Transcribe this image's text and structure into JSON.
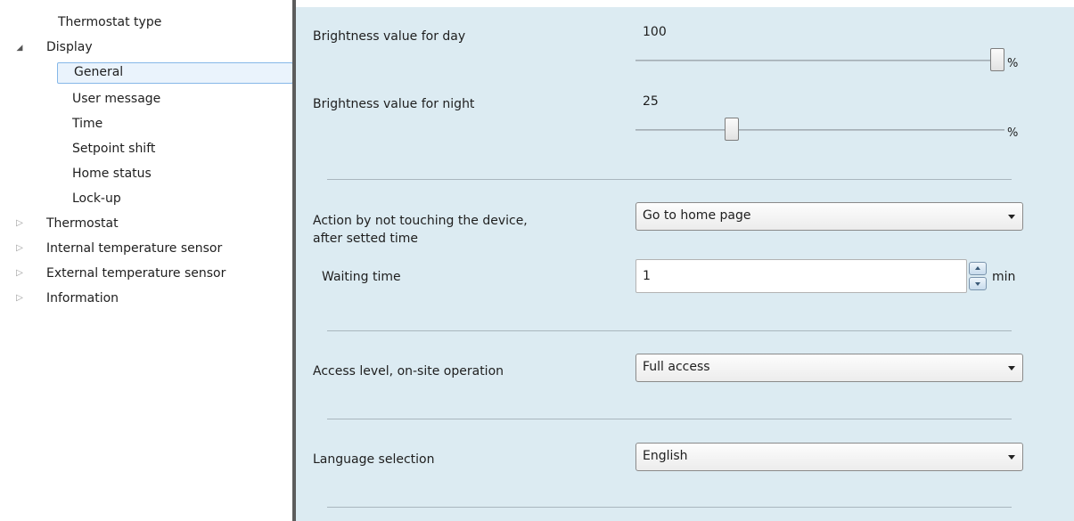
{
  "sidebar": {
    "items": [
      {
        "label": "Thermostat type",
        "state": "leaf"
      },
      {
        "label": "Display",
        "state": "expanded"
      },
      {
        "label": "General",
        "state": "selected"
      },
      {
        "label": "User message",
        "state": "leaf"
      },
      {
        "label": "Time",
        "state": "leaf"
      },
      {
        "label": "Setpoint shift",
        "state": "leaf"
      },
      {
        "label": "Home status",
        "state": "leaf"
      },
      {
        "label": "Lock-up",
        "state": "leaf"
      },
      {
        "label": "Thermostat",
        "state": "collapsed"
      },
      {
        "label": "Internal temperature sensor",
        "state": "collapsed"
      },
      {
        "label": "External temperature sensor",
        "state": "collapsed"
      },
      {
        "label": "Information",
        "state": "collapsed"
      }
    ],
    "arrow_expanded": "◢",
    "arrow_collapsed": "▷"
  },
  "main": {
    "brightness_day": {
      "label": "Brightness value for day",
      "value": "100",
      "unit": "%",
      "level": 1.0
    },
    "brightness_night": {
      "label": "Brightness value for night",
      "value": "25",
      "unit": "%",
      "level": 0.25
    },
    "action": {
      "label_line1": "Action by not touching the device,",
      "label_line2": "after setted time",
      "selected": "Go to home page"
    },
    "waiting_time": {
      "label": "Waiting time",
      "value": "1",
      "unit": "min"
    },
    "access_level": {
      "label": "Access level, on-site operation",
      "selected": "Full access"
    },
    "language": {
      "label": "Language selection",
      "selected": "English"
    }
  },
  "colors": {
    "panel_bg": "#dcebf2",
    "splitter": "#5c5c5c",
    "selection_border": "#86b7e8"
  }
}
